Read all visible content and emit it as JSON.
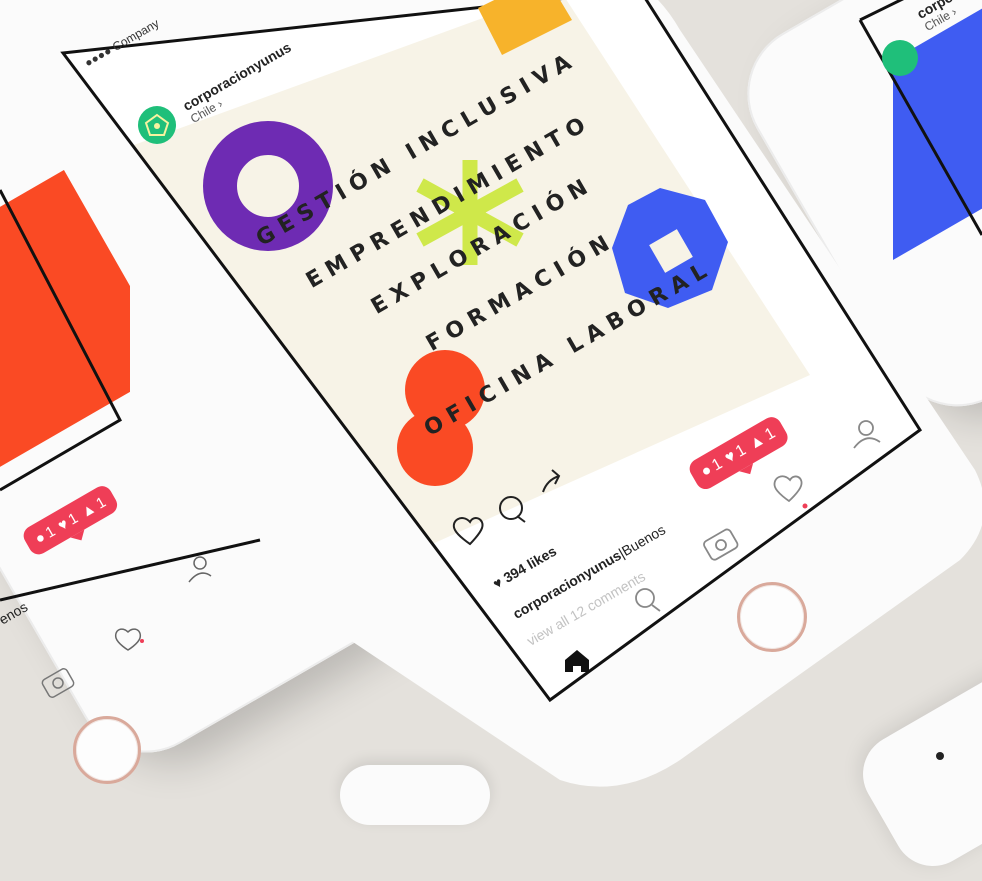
{
  "status_bar": {
    "carrier": "Company"
  },
  "main_post": {
    "account": "corporacionyunus",
    "location": "Chile",
    "location_arrow": "›",
    "poster_lines": [
      "GESTIÓN INCLUSIVA",
      "EMPRENDIMIENTO",
      "EXPLORACIÓN",
      "FORMACIÓN",
      "OFICINA LABORAL"
    ],
    "likes": "394 likes",
    "caption_user": "corporacionyunus",
    "caption_text": "|Buenos",
    "view_comments": "view all 12 comments"
  },
  "notification": {
    "comments": "1",
    "likes": "1",
    "follows": "1"
  },
  "left_post": {
    "caption_fragment": "enos",
    "notification": {
      "comments": "1",
      "likes": "1",
      "follows": "1"
    }
  },
  "right_post": {
    "account": "corpora",
    "location": "Chile",
    "location_arrow": "›"
  },
  "icons": {
    "like": "heart-icon",
    "comment": "comment-icon",
    "share": "share-icon",
    "home": "home-icon",
    "search": "search-icon",
    "camera": "camera-icon",
    "activity": "heart-icon",
    "profile": "profile-icon"
  },
  "colors": {
    "purple": "#6e2bb3",
    "yellow": "#f7b32b",
    "lime": "#cfe84a",
    "blue": "#3f5cf2",
    "orange": "#fa4a24",
    "notif": "#ef3e57",
    "avatar": "#1fbf7a"
  }
}
